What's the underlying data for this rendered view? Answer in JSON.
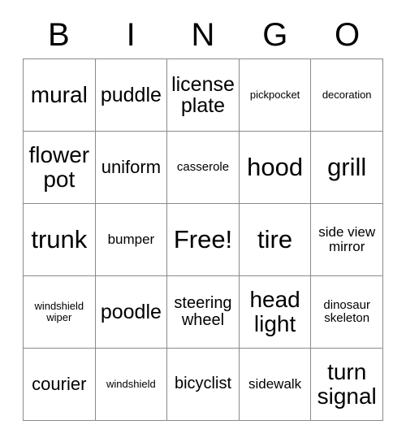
{
  "card": {
    "header_letters": [
      "B",
      "I",
      "N",
      "G",
      "O"
    ],
    "rows": [
      [
        {
          "label": "mural",
          "size": "xl"
        },
        {
          "label": "puddle",
          "size": "l"
        },
        {
          "label": "license plate",
          "size": "l"
        },
        {
          "label": "pickpocket",
          "size": "xxs"
        },
        {
          "label": "decoration",
          "size": "xxs"
        }
      ],
      [
        {
          "label": "flower pot",
          "size": "xl"
        },
        {
          "label": "uniform",
          "size": "m"
        },
        {
          "label": "casserole",
          "size": "xs"
        },
        {
          "label": "hood",
          "size": "xxl"
        },
        {
          "label": "grill",
          "size": "xxl"
        }
      ],
      [
        {
          "label": "trunk",
          "size": "xxl"
        },
        {
          "label": "bumper",
          "size": "s"
        },
        {
          "label": "Free!",
          "size": "xxl"
        },
        {
          "label": "tire",
          "size": "xxl"
        },
        {
          "label": "side view mirror",
          "size": "s"
        }
      ],
      [
        {
          "label": "windshield wiper",
          "size": "xxs"
        },
        {
          "label": "poodle",
          "size": "l"
        },
        {
          "label": "steering wheel",
          "size": "ms"
        },
        {
          "label": "head light",
          "size": "xl"
        },
        {
          "label": "dinosaur skeleton",
          "size": "xs"
        }
      ],
      [
        {
          "label": "courier",
          "size": "m"
        },
        {
          "label": "windshield",
          "size": "xxs"
        },
        {
          "label": "bicyclist",
          "size": "ms"
        },
        {
          "label": "sidewalk",
          "size": "s"
        },
        {
          "label": "turn signal",
          "size": "xl"
        }
      ]
    ],
    "colors": {
      "border": "#8a8a8a",
      "text": "#000000",
      "background": "#ffffff"
    }
  }
}
